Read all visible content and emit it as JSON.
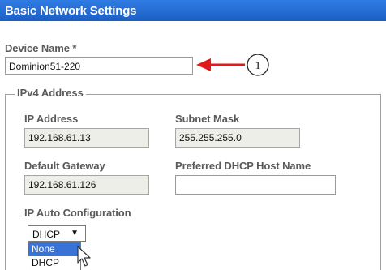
{
  "header": {
    "title": "Basic Network Settings"
  },
  "device_name": {
    "label": "Device Name *",
    "value": "Dominion51-220"
  },
  "callout": {
    "number": "1"
  },
  "ipv4": {
    "legend": "IPv4 Address",
    "ip_address": {
      "label": "IP Address",
      "value": "192.168.61.13"
    },
    "subnet_mask": {
      "label": "Subnet Mask",
      "value": "255.255.255.0"
    },
    "default_gateway": {
      "label": "Default Gateway",
      "value": "192.168.61.126"
    },
    "preferred_dhcp_host_name": {
      "label": "Preferred DHCP Host Name",
      "value": ""
    },
    "ip_auto_configuration": {
      "label": "IP Auto Configuration",
      "selected": "DHCP",
      "arrow": "▼",
      "options": [
        "None",
        "DHCP"
      ],
      "highlighted_option": "None"
    }
  },
  "colors": {
    "header_bar": "#1f66cf",
    "callout_arrow": "#e01a1a",
    "dropdown_highlight": "#3a73d8"
  }
}
